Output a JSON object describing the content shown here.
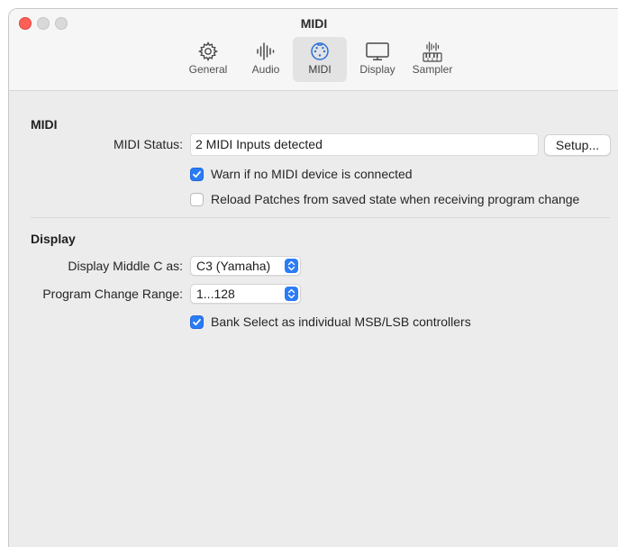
{
  "window": {
    "title": "MIDI"
  },
  "toolbar": {
    "tabs": [
      {
        "label": "General",
        "icon": "gear-icon"
      },
      {
        "label": "Audio",
        "icon": "waveform-icon"
      },
      {
        "label": "MIDI",
        "icon": "midi-connector-icon",
        "active": true
      },
      {
        "label": "Display",
        "icon": "display-icon"
      },
      {
        "label": "Sampler",
        "icon": "sampler-keyboard-icon"
      }
    ]
  },
  "midi_section": {
    "title": "MIDI",
    "status_label": "MIDI Status:",
    "status_value": "2 MIDI Inputs detected",
    "setup_button": "Setup...",
    "warn_checkbox": {
      "label": "Warn if no MIDI device is connected",
      "checked": true
    },
    "reload_checkbox": {
      "label": "Reload Patches from saved state when receiving program change",
      "checked": false
    }
  },
  "display_section": {
    "title": "Display",
    "middle_c_label": "Display Middle C as:",
    "middle_c_value": "C3 (Yamaha)",
    "program_change_label": "Program Change Range:",
    "program_change_value": "1...128",
    "bank_select_checkbox": {
      "label": "Bank Select as individual MSB/LSB controllers",
      "checked": true
    }
  },
  "colors": {
    "accent": "#2b7cf6",
    "close_button": "#fe5f57",
    "window_background": "#ececec",
    "toolbar_background": "#f6f6f6"
  }
}
